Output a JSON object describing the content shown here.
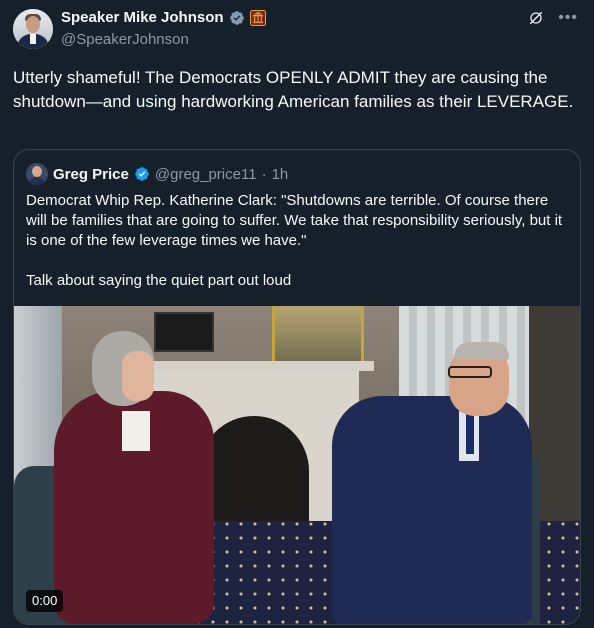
{
  "author": {
    "display_name": "Speaker Mike Johnson",
    "handle": "@SpeakerJohnson"
  },
  "tweet": {
    "text": "Utterly shameful! The Democrats OPENLY ADMIT they are causing the shutdown—and using hardworking American families as their LEVERAGE."
  },
  "quoted": {
    "display_name": "Greg Price",
    "handle": "@greg_price11",
    "separator": "·",
    "time": "1h",
    "text": "Democrat Whip Rep. Katherine Clark: \"Shutdowns are terrible. Of course there will be families that are going to suffer. We take that responsibility seriously, but it is one of the few leverage times we have.\"\n\nTalk about saying the quiet part out loud",
    "video_duration": "0:00"
  },
  "icons": {
    "verified_badge": "gray-verified-badge",
    "affiliate_badge": "us-house-affiliate-icon",
    "quoted_verified_badge": "blue-verified-badge",
    "grok": "grok-icon",
    "more": "more-options-icon"
  },
  "colors": {
    "background": "#15202b",
    "secondary_text": "#8b98a5",
    "verified_blue": "#1d9bf0",
    "verified_gray": "#829aab",
    "border": "#38444d"
  }
}
